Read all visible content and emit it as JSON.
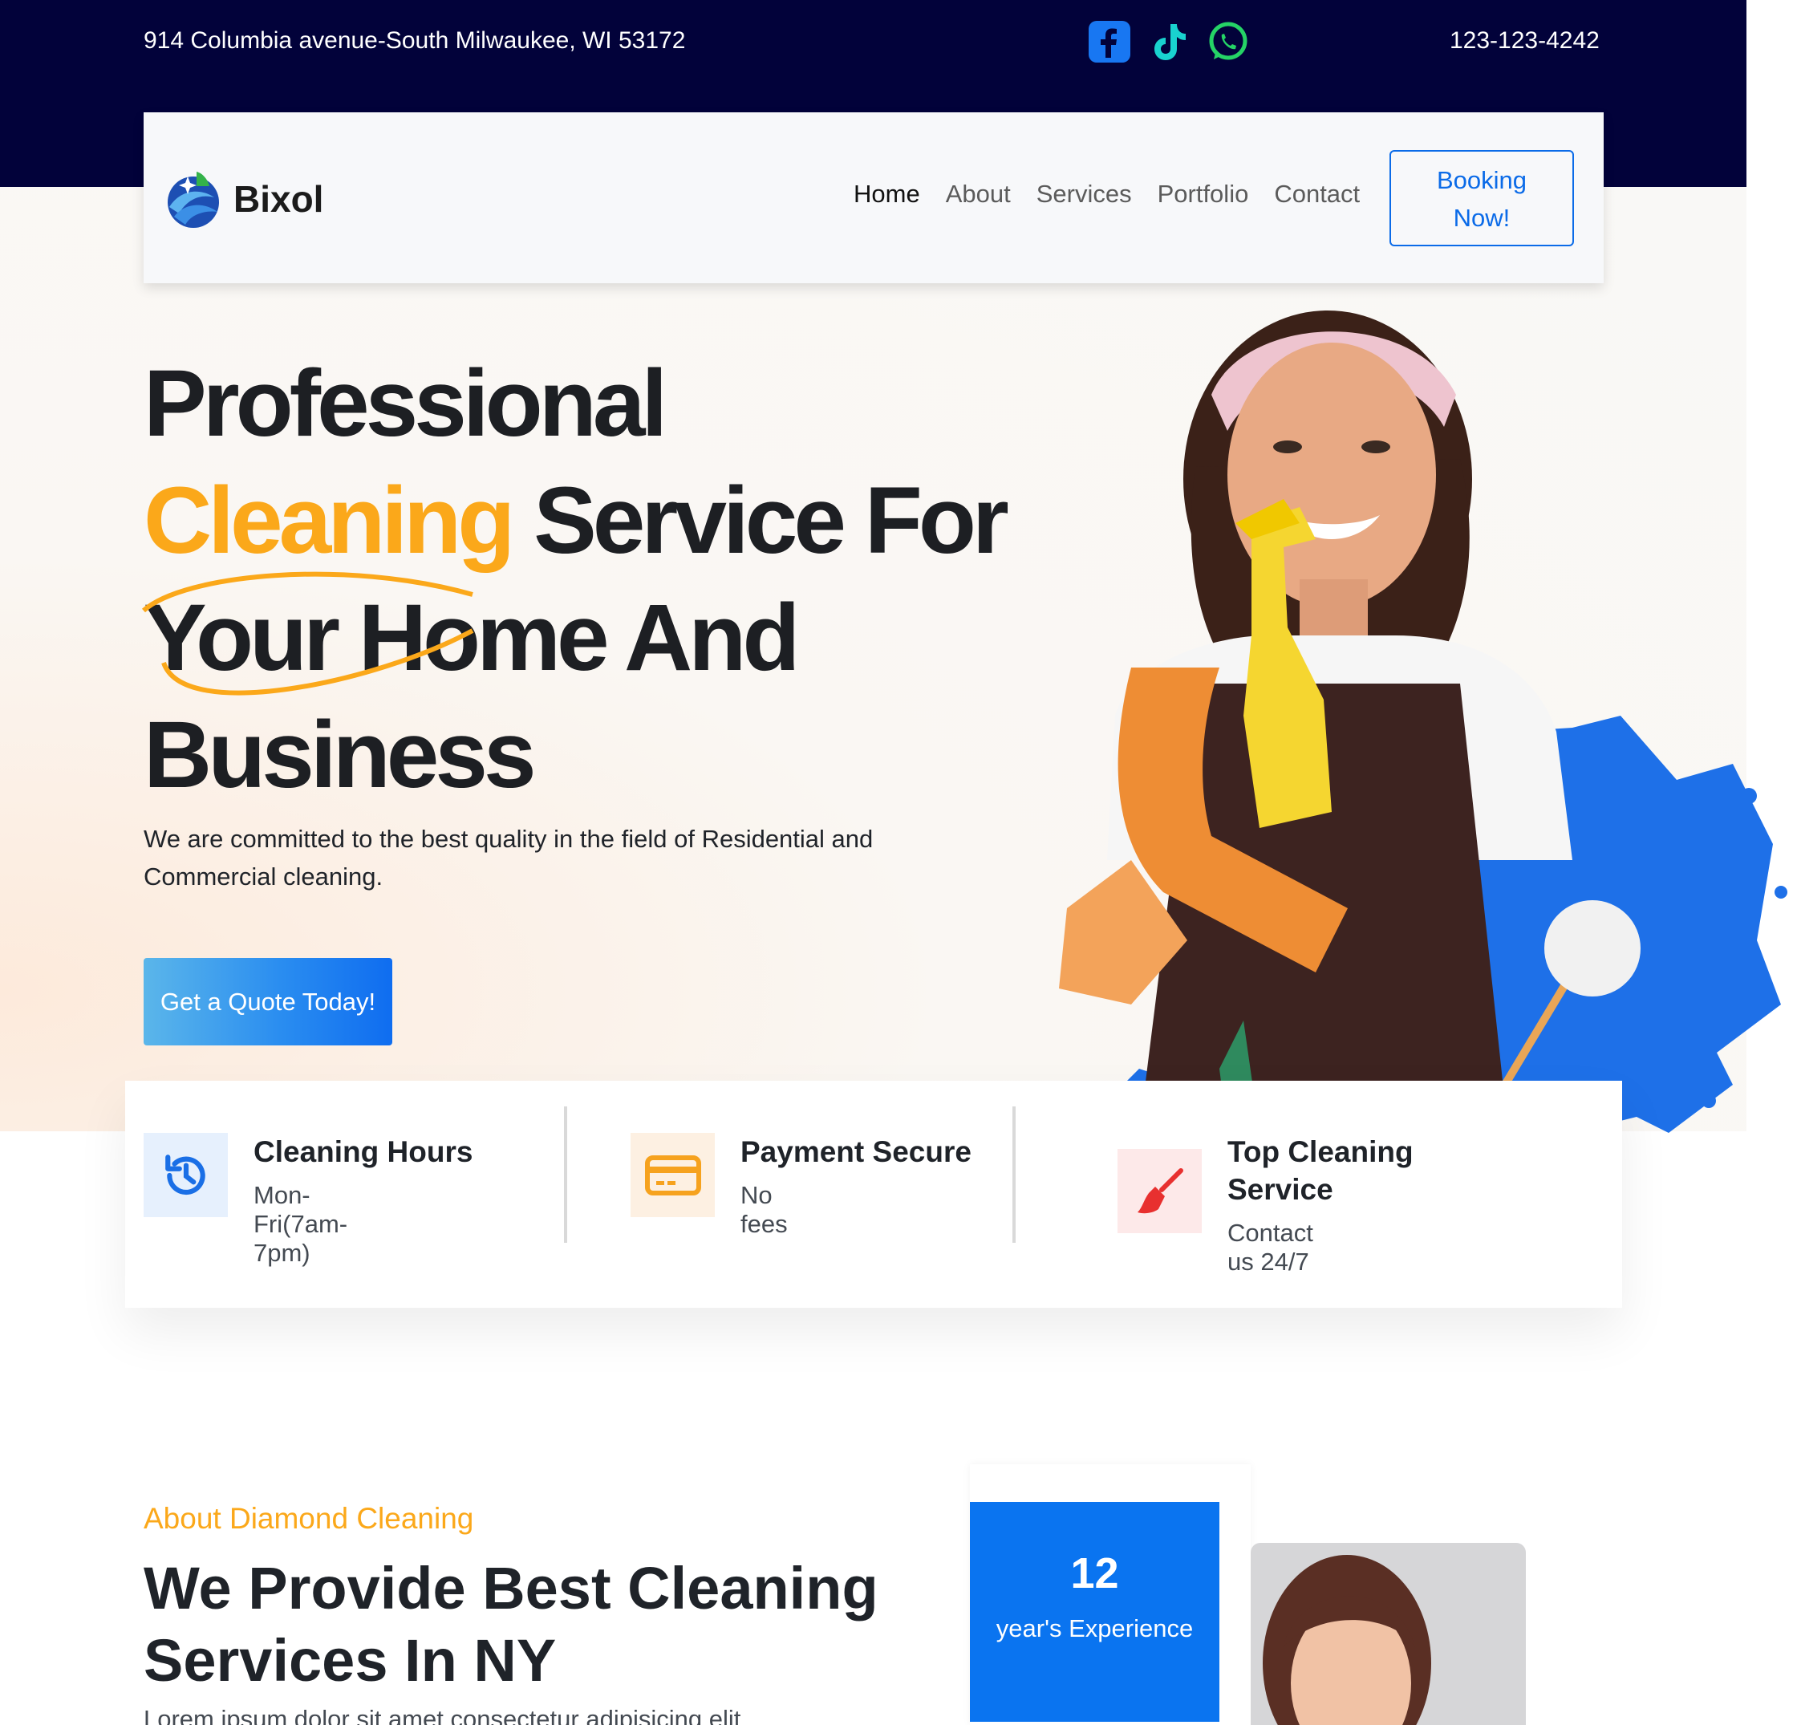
{
  "topbar": {
    "address": "914 Columbia avenue-South Milwaukee, WI 53172",
    "phone": "123-123-4242",
    "socials": [
      "facebook-icon",
      "tiktok-icon",
      "whatsapp-icon"
    ]
  },
  "navbar": {
    "logo_text": "Bixol",
    "links": [
      "Home",
      "About",
      "Services",
      "Portfolio",
      "Contact"
    ],
    "active_link": "Home",
    "booking_line1": "Booking",
    "booking_line2": "Now!"
  },
  "hero": {
    "title_line1": "Professional",
    "title_highlight": "Cleaning",
    "title_line2_rest": " Service For",
    "title_line3": "Your Home And",
    "title_line4": "Business",
    "subtitle": "We are committed to the best quality in the field of Residential and Commercial cleaning.",
    "cta": "Get a Quote Today!"
  },
  "features": [
    {
      "icon": "clock-history-icon",
      "title": "Cleaning Hours",
      "sub": "Mon-Fri(7am-7pm)"
    },
    {
      "icon": "credit-card-icon",
      "title": "Payment Secure",
      "sub": "No fees"
    },
    {
      "icon": "broom-icon",
      "title": "Top Cleaning Service",
      "sub": "Contact us 24/7"
    }
  ],
  "about": {
    "kicker": "About Diamond Cleaning",
    "title": "We Provide Best Cleaning Services In NY",
    "body": "Lorem ipsum dolor sit amet consectetur adipisicing elit",
    "experience_number": "12",
    "experience_label": "year's Experience"
  },
  "colors": {
    "topbar": "#02023a",
    "accent_blue": "#0b6be8",
    "highlight_orange": "#fba81a"
  }
}
